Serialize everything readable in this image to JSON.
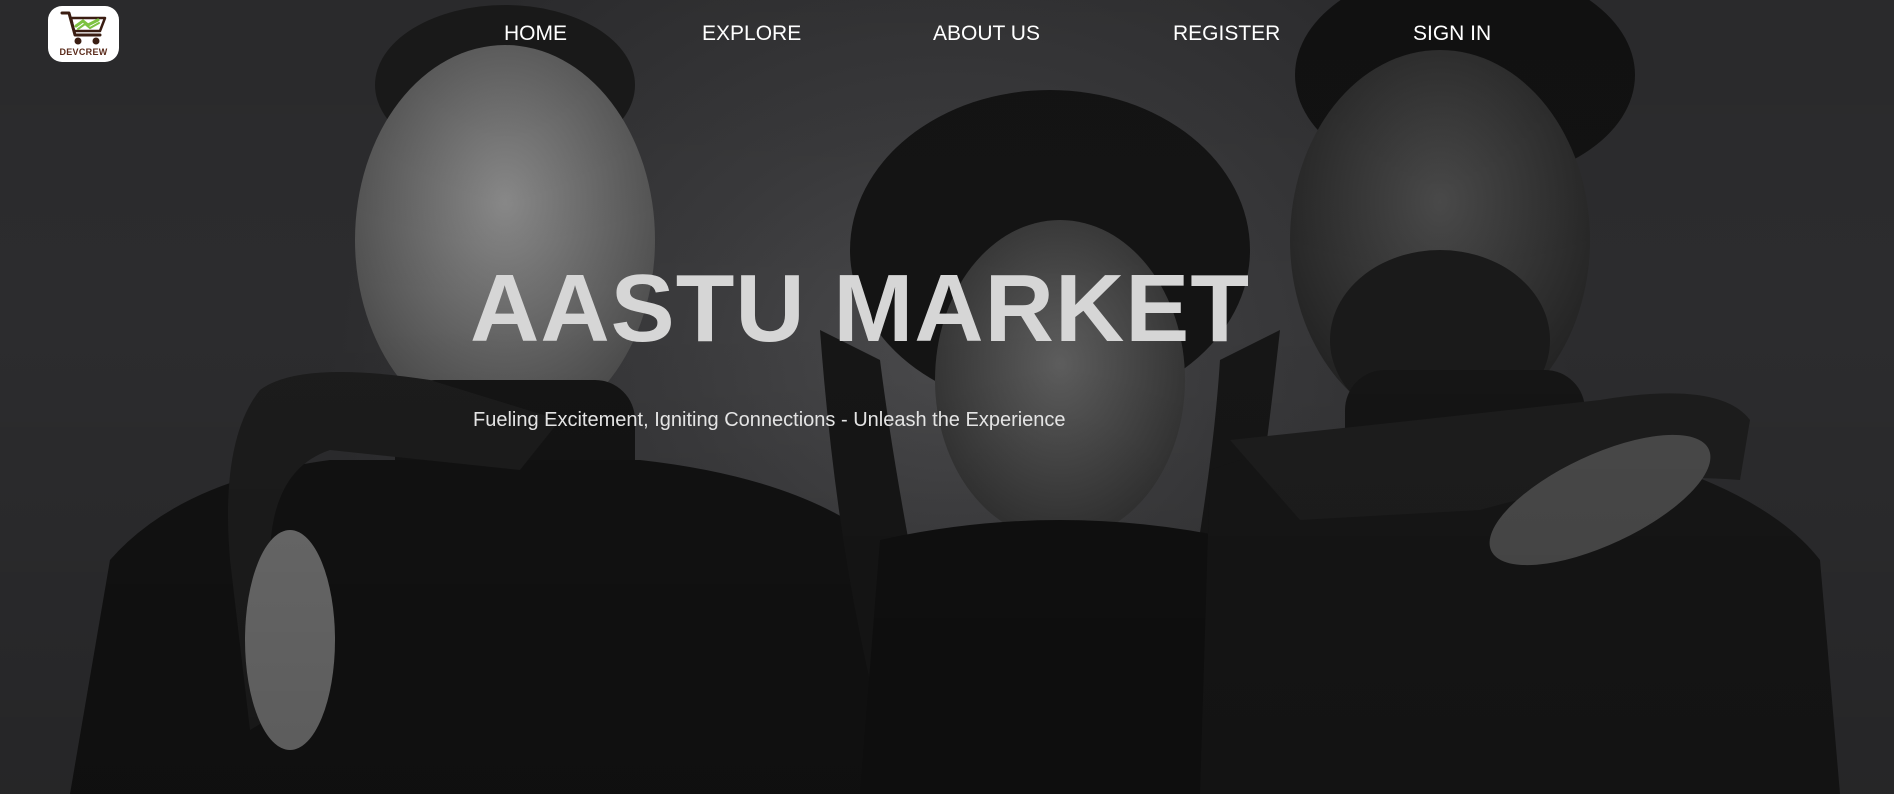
{
  "logo": {
    "text": "DEVCREW",
    "icon": "shopping-cart-icon",
    "colors": {
      "cart": "#3a1d12",
      "accent": "#7dc242"
    }
  },
  "nav": {
    "items": [
      {
        "label": "HOME"
      },
      {
        "label": "EXPLORE"
      },
      {
        "label": "ABOUT US"
      },
      {
        "label": "REGISTER"
      },
      {
        "label": "SIGN IN"
      }
    ]
  },
  "hero": {
    "title": "AASTU MARKET",
    "subtitle": "Fueling Excitement, Igniting Connections - Unleash the Experience"
  },
  "colors": {
    "background": "#2f2f31",
    "nav_text": "#ffffff",
    "title_text": "#d6d6d6"
  }
}
